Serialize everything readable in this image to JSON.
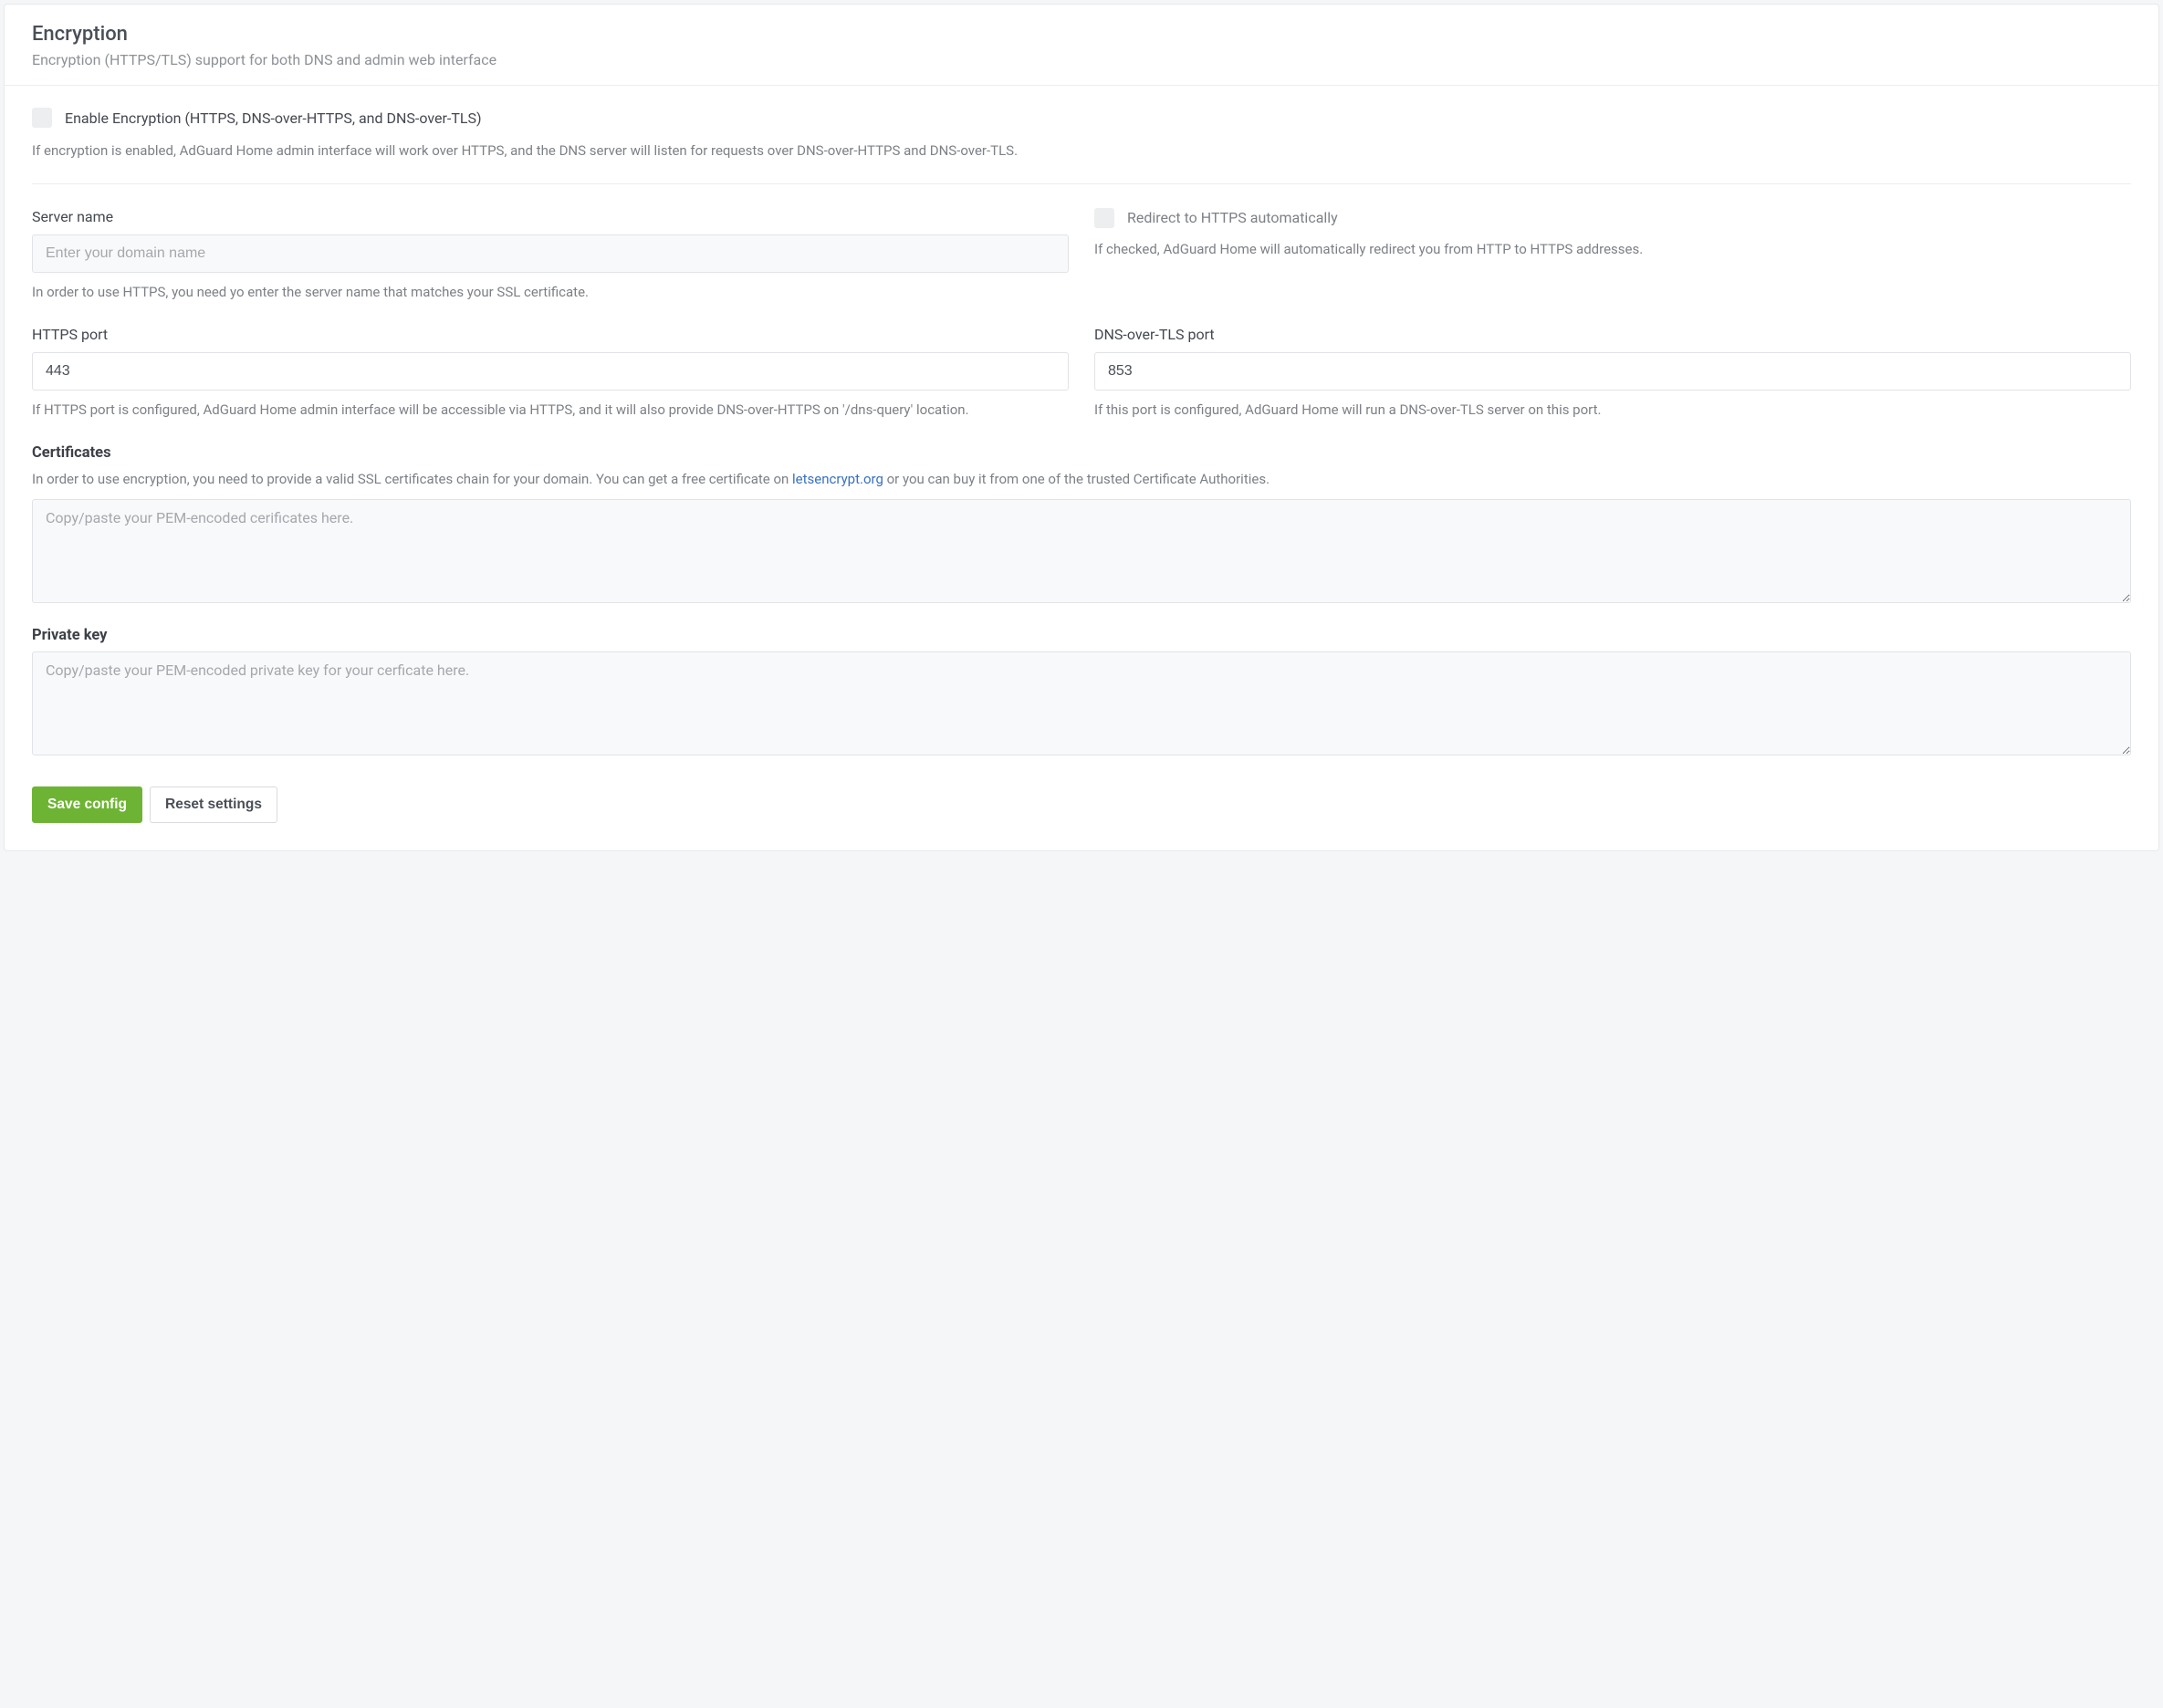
{
  "header": {
    "title": "Encryption",
    "subtitle": "Encryption (HTTPS/TLS) support for both DNS and admin web interface"
  },
  "enable": {
    "label": "Enable Encryption (HTTPS, DNS-over-HTTPS, and DNS-over-TLS)",
    "help": "If encryption is enabled, AdGuard Home admin interface will work over HTTPS, and the DNS server will listen for requests over DNS-over-HTTPS and DNS-over-TLS."
  },
  "server_name": {
    "label": "Server name",
    "placeholder": "Enter your domain name",
    "value": "",
    "help": "In order to use HTTPS, you need yo enter the server name that matches your SSL certificate."
  },
  "redirect": {
    "label": "Redirect to HTTPS automatically",
    "help": "If checked, AdGuard Home will automatically redirect you from HTTP to HTTPS addresses."
  },
  "https_port": {
    "label": "HTTPS port",
    "value": "443",
    "help": "If HTTPS port is configured, AdGuard Home admin interface will be accessible via HTTPS, and it will also provide DNS-over-HTTPS on '/dns-query' location."
  },
  "dot_port": {
    "label": "DNS-over-TLS port",
    "value": "853",
    "help": "If this port is configured, AdGuard Home will run a DNS-over-TLS server on this port."
  },
  "certificates": {
    "title": "Certificates",
    "desc_pre": "In order to use encryption, you need to provide a valid SSL certificates chain for your domain. You can get a free certificate on ",
    "link_text": "letsencrypt.org",
    "desc_post": " or you can buy it from one of the trusted Certificate Authorities.",
    "placeholder": "Copy/paste your PEM-encoded cerificates here.",
    "value": ""
  },
  "private_key": {
    "title": "Private key",
    "placeholder": "Copy/paste your PEM-encoded private key for your cerficate here.",
    "value": ""
  },
  "buttons": {
    "save": "Save config",
    "reset": "Reset settings"
  }
}
